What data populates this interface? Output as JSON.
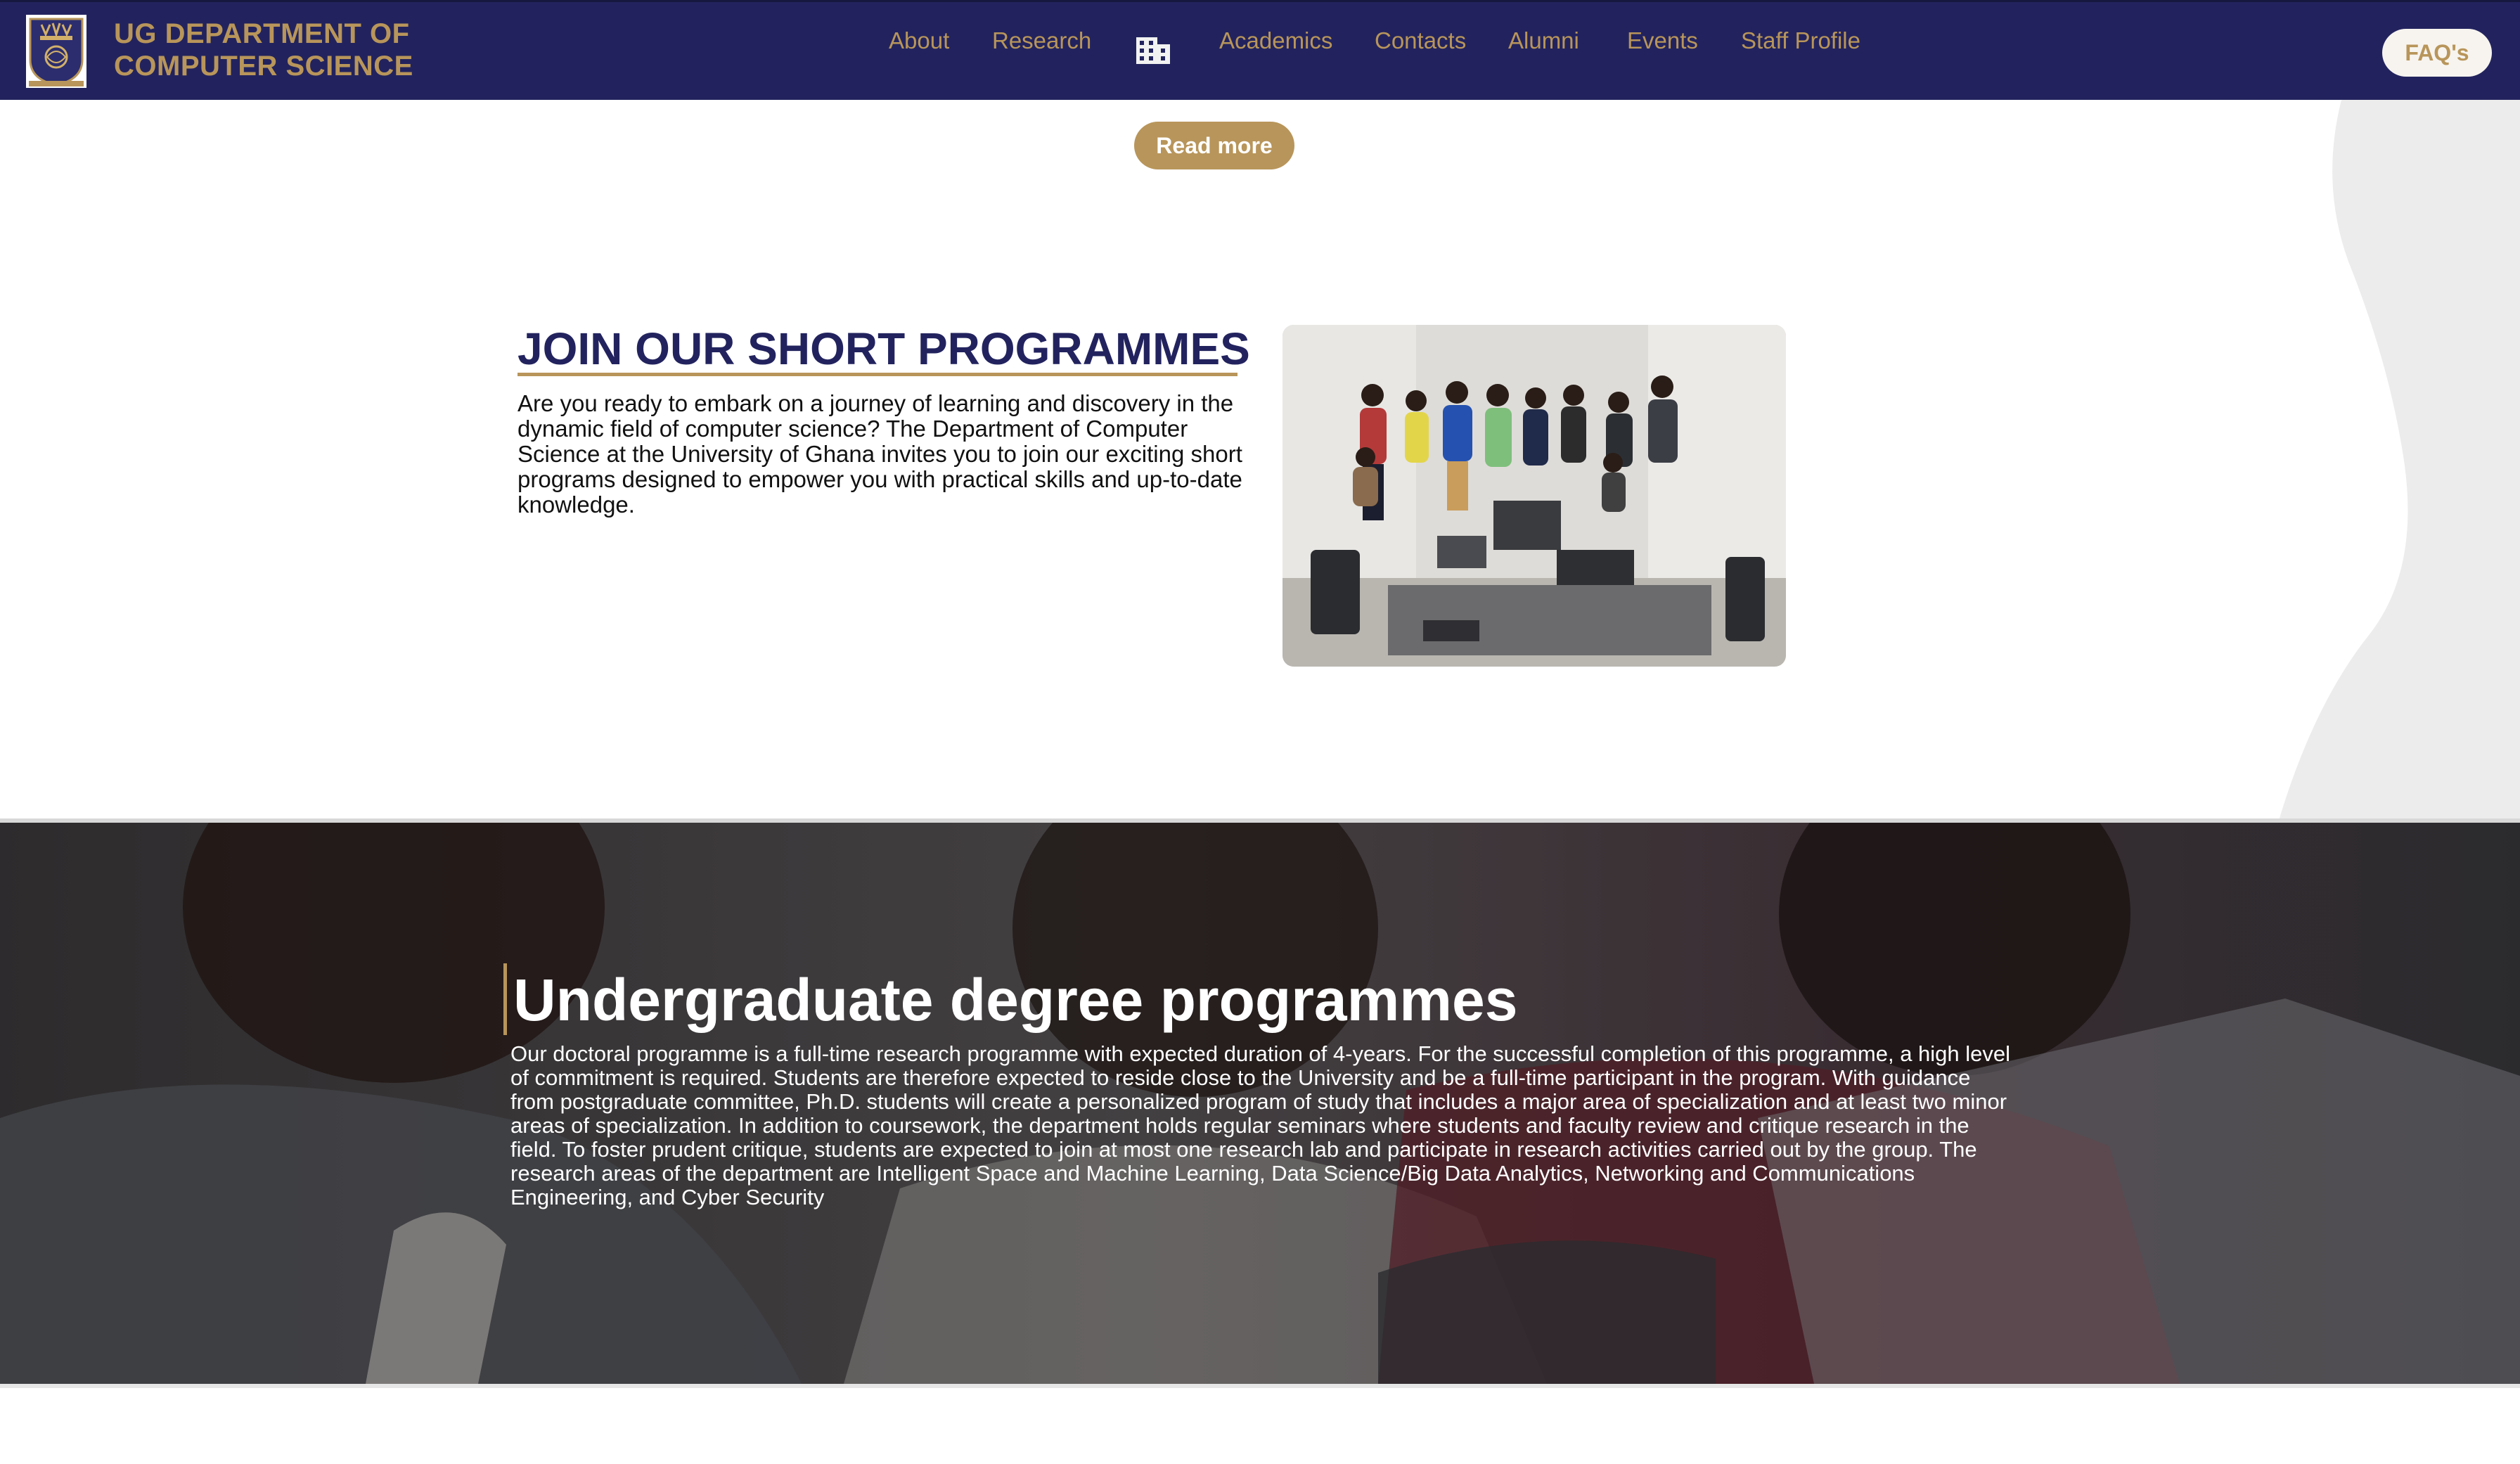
{
  "header": {
    "brand_line1": "UG DEPARTMENT OF",
    "brand_line2": "COMPUTER SCIENCE",
    "nav": [
      {
        "label": "About"
      },
      {
        "label": "Research"
      },
      {
        "label": "Academics"
      },
      {
        "label": "Contacts"
      },
      {
        "label": "Alumni"
      },
      {
        "label": "Events"
      },
      {
        "label": "Staff Profile"
      }
    ],
    "nav_icon": "building-icon",
    "faq_label": "FAQ's"
  },
  "read_more": {
    "label": "Read more"
  },
  "short_programmes": {
    "title": "JOIN OUR SHORT PROGRAMMES",
    "body": "Are you ready to embark on a journey of learning and discovery in the dynamic field of computer science? The Department of Computer Science at the University of Ghana invites you to join our exciting short programs designed to empower you with practical skills and up-to-date knowledge."
  },
  "undergraduate": {
    "title": "Undergraduate degree programmes",
    "body": "Our doctoral programme is a full-time research programme with expected duration of 4-years. For the successful completion of this programme, a high level of commitment is required. Students are therefore expected to reside close to the University and be a full-time participant in the program. With guidance from postgraduate committee, Ph.D. students will create a personalized program of study that includes a major area of specialization and at least two minor areas of specialization. In addition to coursework, the department holds regular seminars where students and faculty review and critique research in the field. To foster prudent critique, students are expected to join at most one research lab and participate in research activities carried out by the group. The research areas of the department are Intelligent Space and Machine Learning, Data Science/Big Data Analytics, Networking and Communications Engineering, and Cyber Security"
  },
  "colors": {
    "navy": "#22235e",
    "gold": "#b8955a",
    "faq_bg": "#f7f4ef",
    "banner_bg": "#4a4749"
  }
}
